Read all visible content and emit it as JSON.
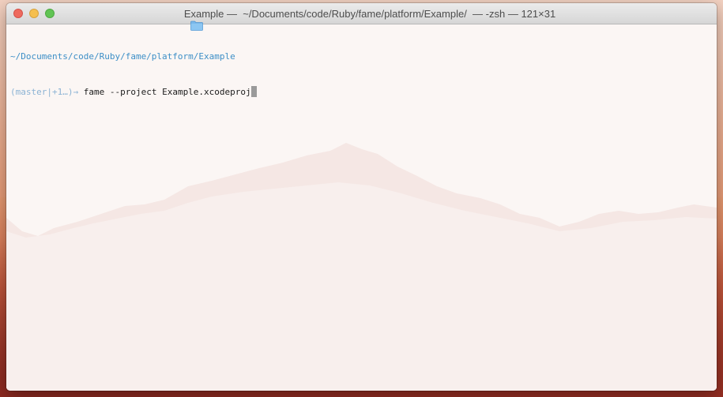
{
  "window": {
    "title": "Example —  ~/Documents/code/Ruby/fame/platform/Example/  — -zsh — 121×31",
    "icon": "folder-icon",
    "buttons": [
      "close-button",
      "minimize-button",
      "zoom-button"
    ]
  },
  "terminal": {
    "cwd": "~/Documents/code/Ruby/fame/platform/Example",
    "prompt_branch": "(master|+1…)",
    "prompt_arrow": "→",
    "command": "fame --project Example.xcodeproj"
  },
  "colors": {
    "path": "#3d8fc7",
    "prompt": "#8bb3d4",
    "command": "#1c1c1c",
    "cursor": "#9a9a9a"
  }
}
